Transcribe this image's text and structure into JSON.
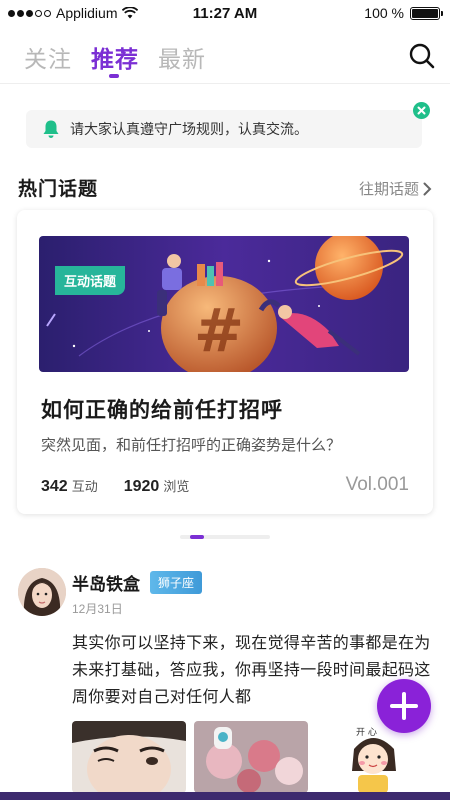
{
  "status_bar": {
    "carrier": "Applidium",
    "time": "11:27 AM",
    "battery": "100 %",
    "battery_level": 1.0,
    "signal_bars": 3,
    "signal_total": 5
  },
  "tabs": [
    {
      "label": "关注",
      "active": false
    },
    {
      "label": "推荐",
      "active": true
    },
    {
      "label": "最新",
      "active": false
    }
  ],
  "search": {
    "icon": "search-icon"
  },
  "notice": {
    "icon": "bell-icon",
    "text": "请大家认真遵守广场规则，认真交流。",
    "close_icon": "close-icon"
  },
  "hot_topics": {
    "title": "热门话题",
    "more": "往期话题",
    "card": {
      "tag": "互动话题",
      "title": "如何正确的给前任打招呼",
      "desc": "突然见面，和前任打招呼的正确姿势是什么？",
      "interactions": "342",
      "interactions_label": "互动",
      "views": "1920",
      "views_label": "浏览",
      "vol": "Vol.001"
    },
    "pager_count": 1
  },
  "post": {
    "author": "半岛铁盒",
    "zodiac": "狮子座",
    "date": "12月31日",
    "text": "其实你可以坚持下来，现在觉得辛苦的事都是在为未来打基础，答应我，你再坚持一段时间最起码这周你要对自己对任何人都"
  },
  "fab": {
    "icon": "plus-icon"
  },
  "colors": {
    "accent": "#7b2fd4",
    "tag_green": "#27b59a",
    "badge_blue": "#3f9ad8",
    "fab": "#8a22d8"
  }
}
